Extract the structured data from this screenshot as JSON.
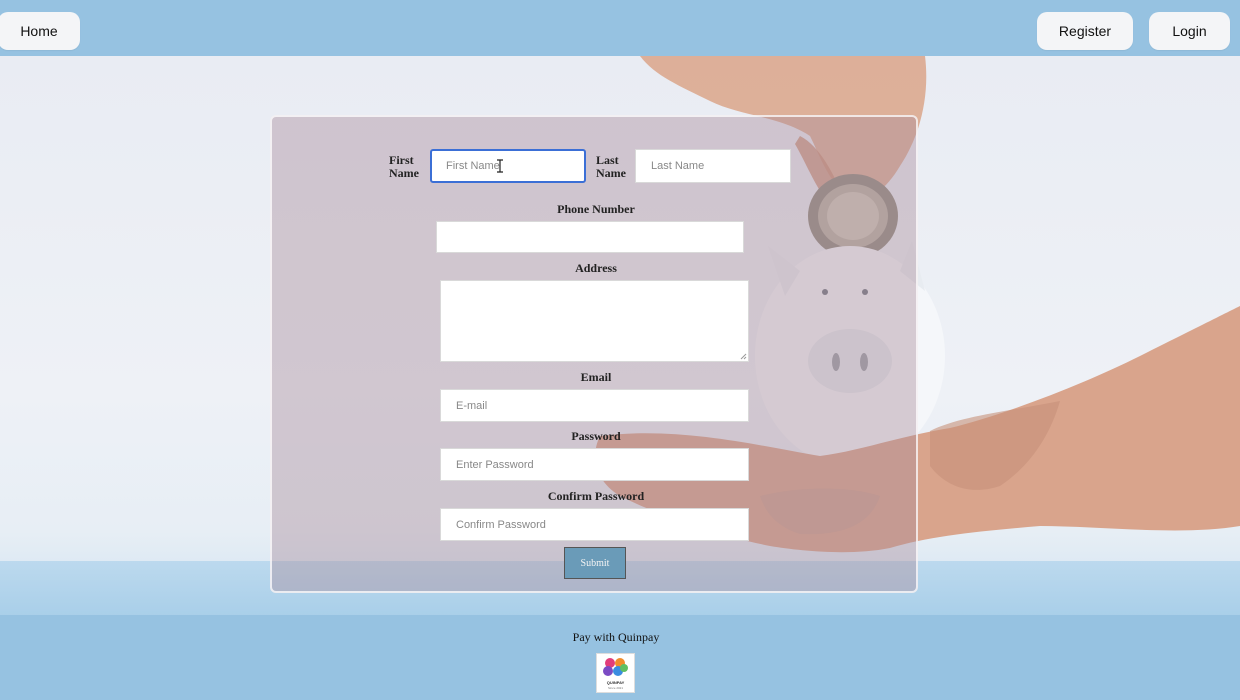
{
  "header": {
    "home_label": "Home",
    "register_label": "Register",
    "login_label": "Login"
  },
  "form": {
    "first_name_label": "First Name",
    "first_name_placeholder": "First Name",
    "last_name_label": "Last Name",
    "last_name_placeholder": "Last Name",
    "phone_label": "Phone Number",
    "phone_value": "",
    "address_label": "Address",
    "address_value": "",
    "email_label": "Email",
    "email_placeholder": "E-mail",
    "password_label": "Password",
    "password_placeholder": "Enter Password",
    "confirm_password_label": "Confirm Password",
    "confirm_password_placeholder": "Confirm Password",
    "submit_label": "Submit"
  },
  "footer": {
    "text": "Pay with Quinpay",
    "logo_text": "QUINPAY",
    "logo_subtext": "Since 2021"
  },
  "colors": {
    "bar": "#96c2e1",
    "focus": "#3b6fd6",
    "submit": "#6a9bb8"
  },
  "icons": {
    "cursor": "text-cursor-icon",
    "resize": "resize-handle-icon",
    "logo": "quinpay-logo-icon"
  }
}
